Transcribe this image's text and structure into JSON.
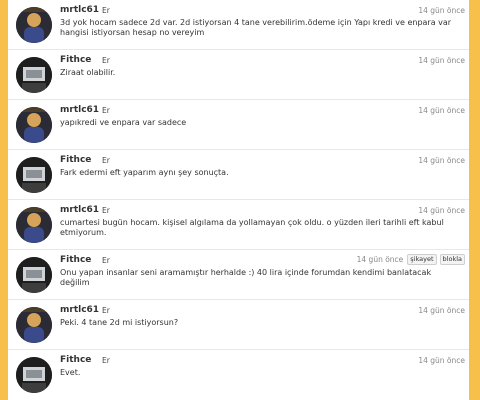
{
  "messages": [
    {
      "author": "mrtlc61",
      "gender": "Er",
      "date": "14 gün önce",
      "text": "3d yok hocam sadece 2d var. 2d istiyorsan 4 tane verebilirim.ödeme için Yapı kredi ve enpara var hangisi istiyorsan hesap no vereyim",
      "avatar": "mrtlc61-avatar"
    },
    {
      "author": "Fithce",
      "gender": "Er",
      "date": "14 gün önce",
      "text": "Ziraat olabilir.",
      "avatar": "fithce-avatar"
    },
    {
      "author": "mrtlc61",
      "gender": "Er",
      "date": "14 gün önce",
      "text": "yapıkredi ve enpara var sadece",
      "avatar": "mrtlc61-avatar"
    },
    {
      "author": "Fithce",
      "gender": "Er",
      "date": "14 gün önce",
      "text": "Fark edermi eft yaparım aynı şey sonuçta.",
      "avatar": "fithce-avatar"
    },
    {
      "author": "mrtlc61",
      "gender": "Er",
      "date": "14 gün önce",
      "text": "cumartesi bugün hocam. kişisel algılama da yollamayan çok oldu. o yüzden ileri tarihli eft kabul etmiyorum.",
      "avatar": "mrtlc61-avatar"
    },
    {
      "author": "Fithce",
      "gender": "Er",
      "date": "14 gün önce",
      "text": "Onu yapan insanlar seni aramamıştır herhalde :) 40 lira içinde forumdan kendimi banlatacak değilim",
      "avatar": "fithce-avatar",
      "actions": {
        "report_label": "şikayet",
        "block_label": "blokla"
      }
    },
    {
      "author": "mrtlc61",
      "gender": "Er",
      "date": "14 gün önce",
      "text": "Peki. 4 tane 2d mi istiyorsun?",
      "avatar": "mrtlc61-avatar"
    },
    {
      "author": "Fithce",
      "gender": "Er",
      "date": "14 gün önce",
      "text": "Evet.",
      "avatar": "fithce-avatar"
    }
  ],
  "colors": {
    "frame": "#f6c04a",
    "text": "#333333",
    "muted": "#888888"
  }
}
